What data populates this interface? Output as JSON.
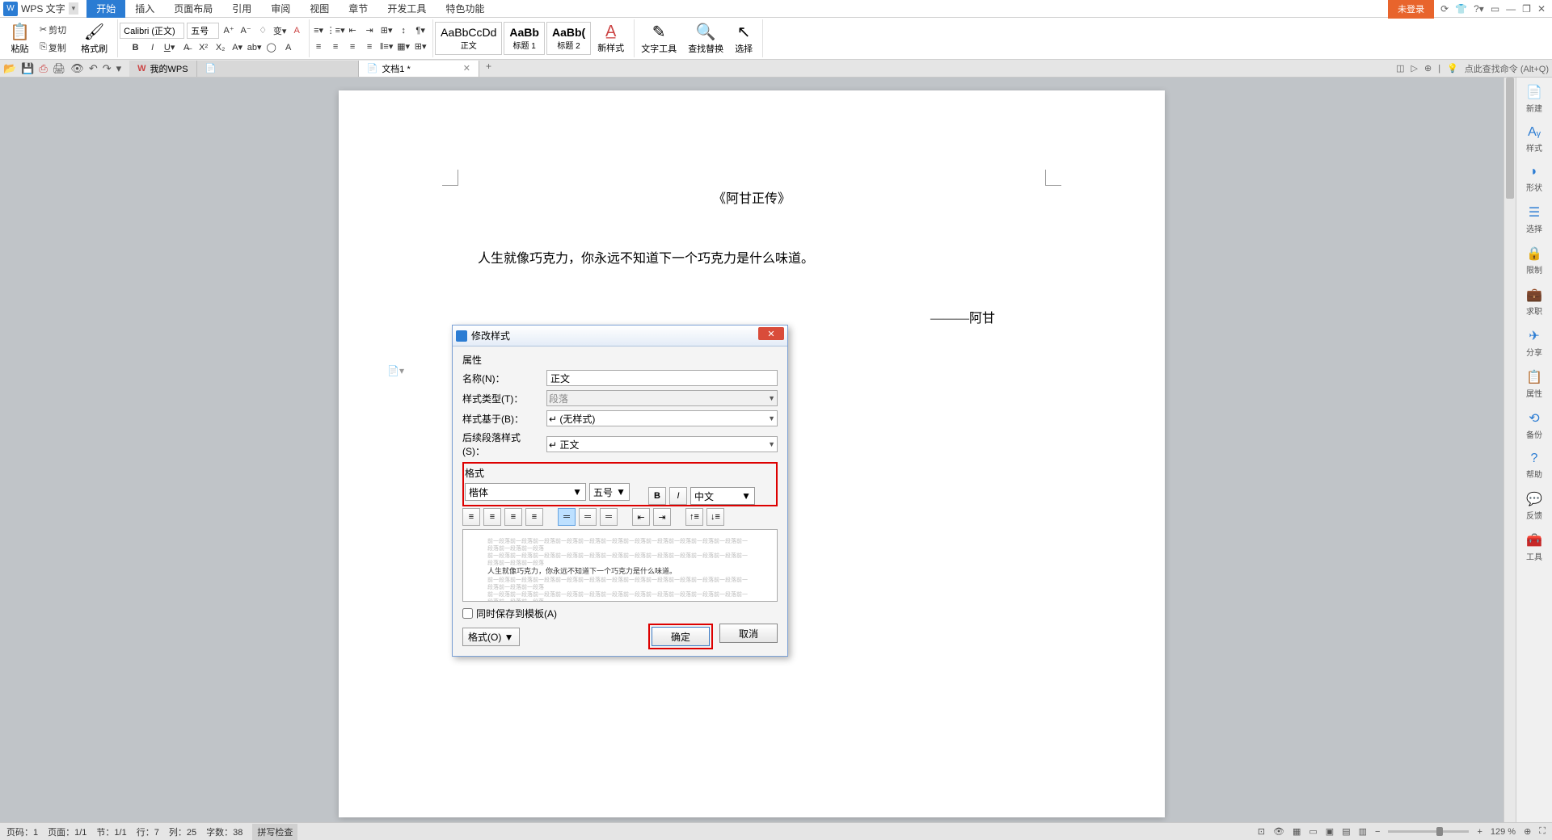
{
  "app": {
    "name": "WPS 文字",
    "login": "未登录"
  },
  "menu": {
    "tabs": [
      "开始",
      "插入",
      "页面布局",
      "引用",
      "审阅",
      "视图",
      "章节",
      "开发工具",
      "特色功能"
    ],
    "active": 0
  },
  "ribbon": {
    "paste": "粘贴",
    "cut": "剪切",
    "copy": "复制",
    "format_painter": "格式刷",
    "font": "Calibri (正文)",
    "size": "五号",
    "styles": [
      {
        "preview": "AaBbCcDd",
        "name": "正文"
      },
      {
        "preview": "AaBb",
        "name": "标题 1"
      },
      {
        "preview": "AaBb(",
        "name": "标题 2"
      }
    ],
    "new_style": "新样式",
    "text_tools": "文字工具",
    "find_replace": "查找替换",
    "select": "选择"
  },
  "tabs": {
    "my_wps": "我的WPS",
    "doc1": "文档1 *"
  },
  "search_hint": "点此查找命令 (Alt+Q)",
  "document": {
    "title": "《阿甘正传》",
    "body": "人生就像巧克力，你永远不知道下一个巧克力是什么味道。",
    "author": "———阿甘"
  },
  "dialog": {
    "title": "修改样式",
    "section_props": "属性",
    "name_label": "名称(N)：",
    "name_value": "正文",
    "type_label": "样式类型(T)：",
    "type_value": "段落",
    "based_label": "样式基于(B)：",
    "based_value": "↵ (无样式)",
    "next_label": "后续段落样式(S)：",
    "next_value": "↵ 正文",
    "section_format": "格式",
    "font": "楷体",
    "size": "五号",
    "lang": "中文",
    "save_template": "同时保存到模板(A)",
    "format_btn": "格式(O)",
    "ok": "确定",
    "cancel": "取消",
    "preview": "前一段落前一段落前一段落前一段落前一段落前一段落前一段落前一段落前一段落前一段落前一段落前一段落前一段落前一段落"
  },
  "panel": [
    "新建",
    "样式",
    "形状",
    "选择",
    "限制",
    "求职",
    "分享",
    "属性",
    "备份",
    "帮助",
    "反馈",
    "工具"
  ],
  "status": {
    "page": "页码：1",
    "pages": "页面：1/1",
    "section": "节：1/1",
    "line": "行：7",
    "col": "列：25",
    "words": "字数：38",
    "spell": "拼写检查",
    "zoom": "129 %"
  }
}
